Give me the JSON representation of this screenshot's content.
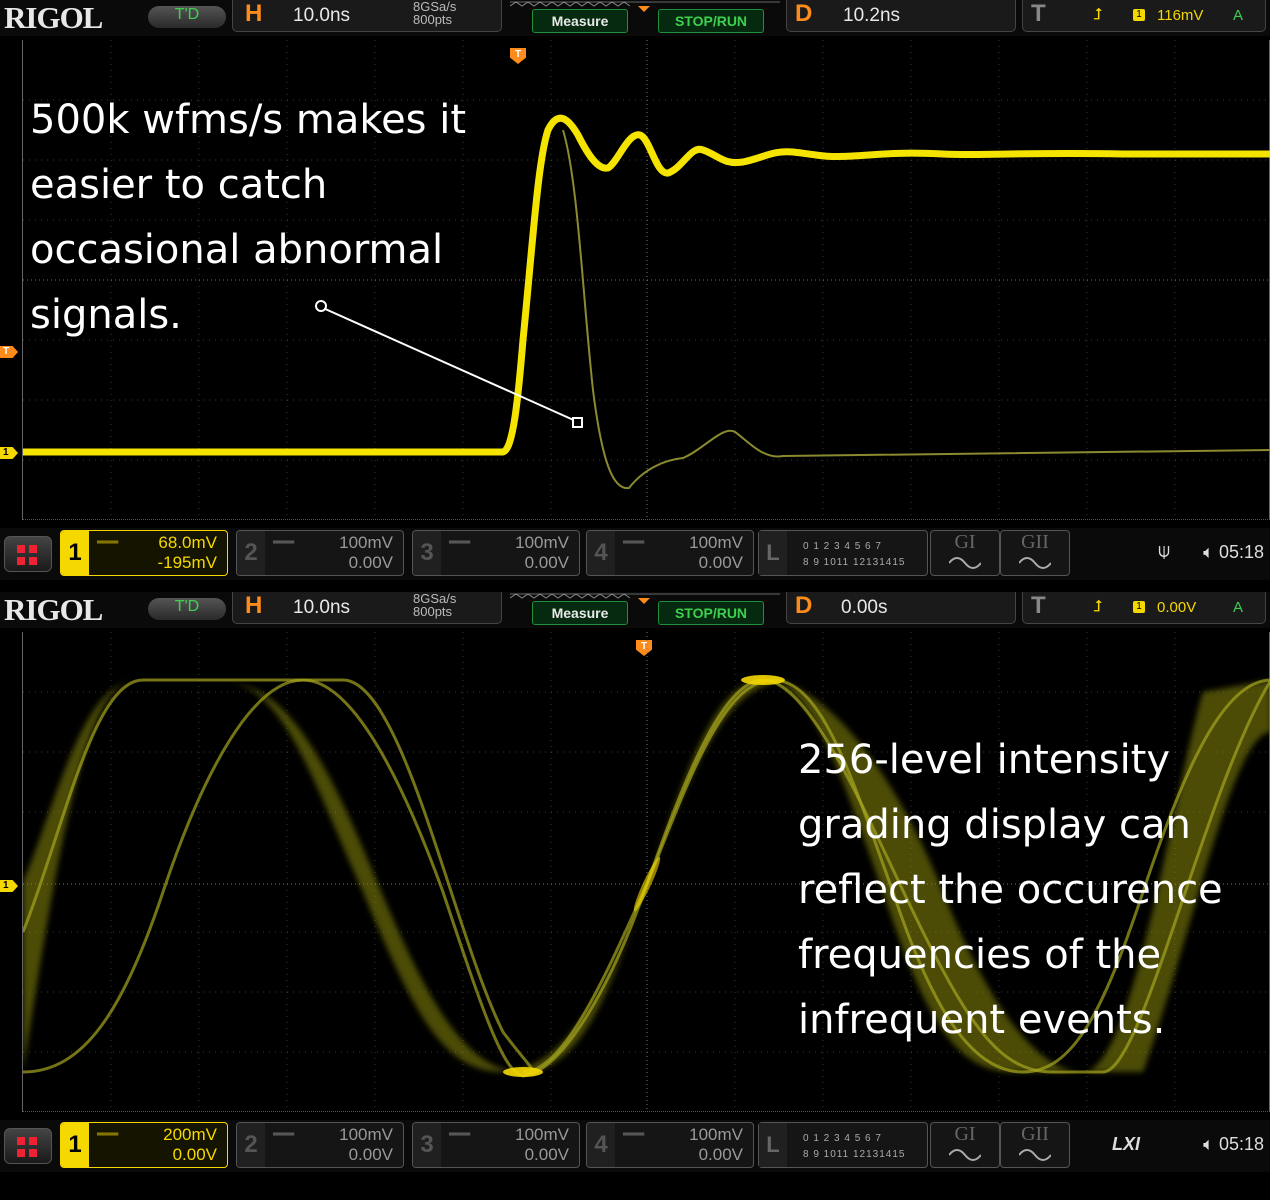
{
  "scopes": [
    {
      "id": "top",
      "logo": "RIGOL",
      "mode": "T'D",
      "h_label": "H",
      "h_timebase": "10.0ns",
      "sample_rate": "8GSa/s",
      "points": "800pts",
      "measure_label": "Measure",
      "stoprun_label": "STOP/RUN",
      "d_label": "D",
      "d_delay": "10.2ns",
      "t_label": "T",
      "trigger_channel": "1",
      "trigger_level": "116mV",
      "trigger_coupling": "A",
      "annotation_lines": [
        "500k wfms/s makes it",
        "easier to catch",
        "occasional abnormal",
        "signals."
      ],
      "channels": [
        {
          "num": "1",
          "scale": "68.0mV",
          "offset": "-195mV",
          "active": true
        },
        {
          "num": "2",
          "scale": "100mV",
          "offset": "0.00V",
          "active": false
        },
        {
          "num": "3",
          "scale": "100mV",
          "offset": "0.00V",
          "active": false
        },
        {
          "num": "4",
          "scale": "100mV",
          "offset": "0.00V",
          "active": false
        }
      ],
      "logic_label": "L",
      "logic_row1": "0 1 2 3  4 5 6 7",
      "logic_row2": "8 9 1011 12131415",
      "gi_label": "GI",
      "gii_label": "GII",
      "status_icon": "usb-icon",
      "time": "05:18",
      "markers": {
        "trigger_level": "T",
        "channel": "1",
        "trigger_pos": "T"
      }
    },
    {
      "id": "bottom",
      "logo": "RIGOL",
      "mode": "T'D",
      "h_label": "H",
      "h_timebase": "10.0ns",
      "sample_rate": "8GSa/s",
      "points": "800pts",
      "measure_label": "Measure",
      "stoprun_label": "STOP/RUN",
      "d_label": "D",
      "d_delay": "0.00s",
      "t_label": "T",
      "trigger_channel": "1",
      "trigger_level": "0.00V",
      "trigger_coupling": "A",
      "annotation_lines": [
        "256-level intensity",
        "grading display can",
        "reflect the occurence",
        "frequencies of the",
        "infrequent events."
      ],
      "channels": [
        {
          "num": "1",
          "scale": "200mV",
          "offset": "0.00V",
          "active": true
        },
        {
          "num": "2",
          "scale": "100mV",
          "offset": "0.00V",
          "active": false
        },
        {
          "num": "3",
          "scale": "100mV",
          "offset": "0.00V",
          "active": false
        },
        {
          "num": "4",
          "scale": "100mV",
          "offset": "0.00V",
          "active": false
        }
      ],
      "logic_label": "L",
      "logic_row1": "0 1 2 3  4 5 6 7",
      "logic_row2": "8 9 1011 12131415",
      "gi_label": "GI",
      "gii_label": "GII",
      "lxi_label": "LXI",
      "time": "05:18",
      "markers": {
        "channel": "1",
        "trigger_pos": "T"
      }
    }
  ],
  "colors": {
    "ch1": "#f5d800",
    "accent": "#ff8c1a",
    "run_green": "#3fd050"
  }
}
